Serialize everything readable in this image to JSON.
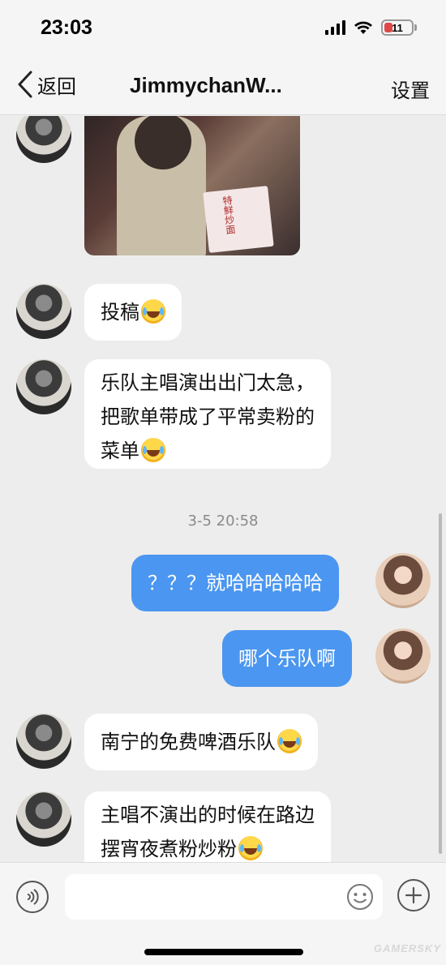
{
  "status_bar": {
    "time": "23:03",
    "battery_level": "11",
    "battery_color": "#e04848"
  },
  "nav": {
    "back_label": "返回",
    "title": "JimmychanW...",
    "settings_label": "设置"
  },
  "messages": [
    {
      "side": "left",
      "kind": "image",
      "icon": "photo"
    },
    {
      "side": "left",
      "kind": "text",
      "lines": [
        "投稿"
      ],
      "emoji": true
    },
    {
      "side": "left",
      "kind": "text",
      "lines": [
        "乐队主唱演出出门太急，",
        "把歌单带成了平常卖粉的",
        "菜单"
      ],
      "emoji": true
    },
    {
      "kind": "timestamp",
      "text": "3-5 20:58"
    },
    {
      "side": "right",
      "kind": "text",
      "lines": [
        "？？？就哈哈哈哈哈"
      ],
      "emoji": false
    },
    {
      "side": "right",
      "kind": "text",
      "lines": [
        "哪个乐队啊"
      ],
      "emoji": false
    },
    {
      "side": "left",
      "kind": "text",
      "lines": [
        "南宁的免费啤酒乐队"
      ],
      "emoji": true
    },
    {
      "side": "left",
      "kind": "text",
      "lines": [
        "主唱不演出的时候在路边",
        "摆宵夜煮粉炒粉"
      ],
      "emoji": true
    }
  ],
  "photo_menu_text": "特鲜炒面",
  "input_bar": {
    "placeholder": "",
    "voice_icon": "voice-icon",
    "emoji_icon": "emoji-icon",
    "add_icon": "plus-icon"
  },
  "colors": {
    "sent_bubble": "#4b96f0",
    "received_bubble": "#ffffff",
    "background": "#ededed"
  },
  "watermark": "GAMERSKY"
}
